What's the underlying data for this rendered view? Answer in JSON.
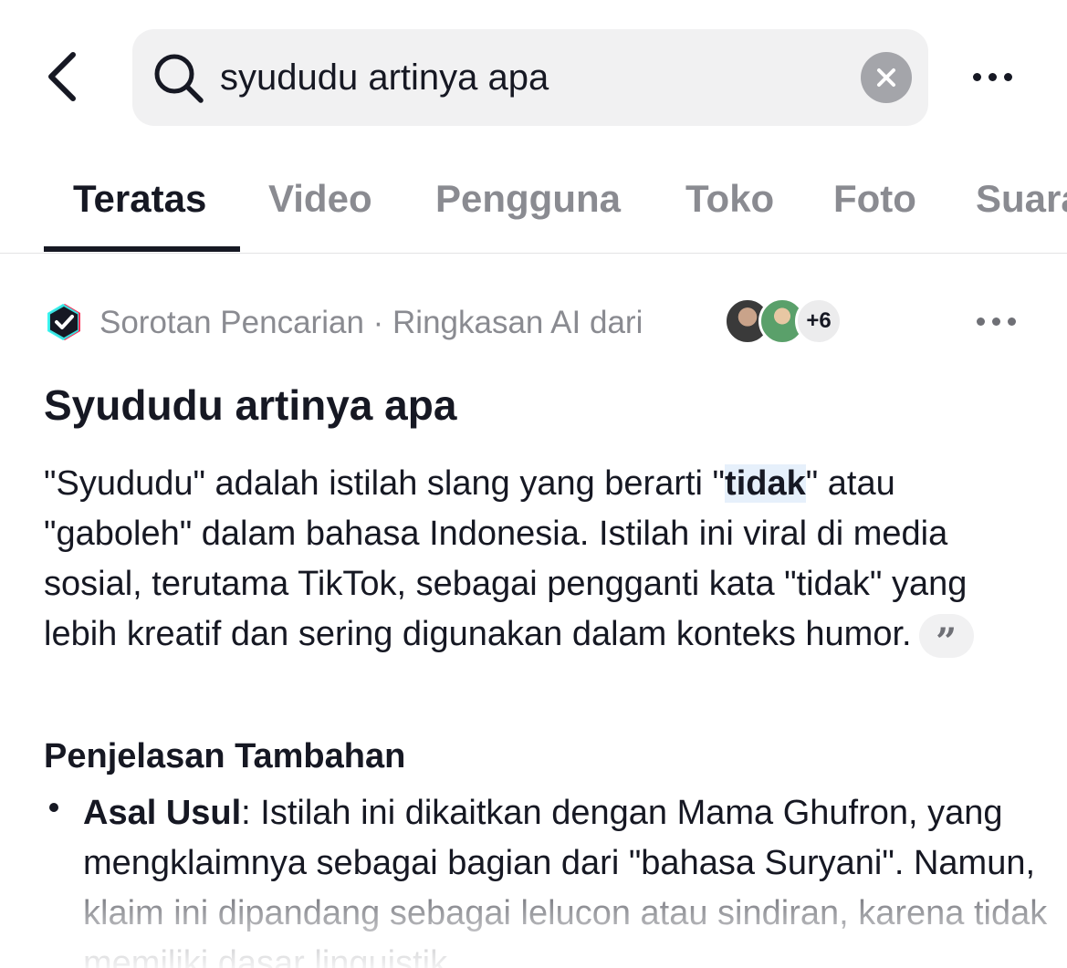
{
  "search": {
    "query": "syududu artinya apa"
  },
  "tabs": [
    {
      "label": "Teratas",
      "active": true
    },
    {
      "label": "Video",
      "active": false
    },
    {
      "label": "Pengguna",
      "active": false
    },
    {
      "label": "Toko",
      "active": false
    },
    {
      "label": "Foto",
      "active": false
    },
    {
      "label": "Suara",
      "active": false
    }
  ],
  "source": {
    "label": "Sorotan Pencarian · Ringkasan AI dari",
    "more_count": "+6"
  },
  "article": {
    "title": "Syududu artinya apa",
    "para_pre": "\"Syududu\" adalah istilah slang yang berarti \"",
    "para_highlight": "tidak",
    "para_post": "\" atau \"gaboleh\" dalam bahasa Indonesia. Istilah ini viral di media sosial, terutama TikTok, sebagai pengganti kata \"tidak\" yang lebih kreatif dan sering digunakan dalam konteks humor.",
    "quote_icon_glyph": "”",
    "subheading": "Penjelasan Tambahan",
    "bullet_label": "Asal Usul",
    "bullet_text": ": Istilah ini dikaitkan dengan Mama Ghufron, yang mengklaimnya sebagai bagian dari \"bahasa Suryani\". Namun, klaim ini dipandang sebagai lelucon atau sindiran, karena tidak memiliki dasar linguistik"
  },
  "colors": {
    "text": "#161823",
    "muted": "#8a8b91",
    "highlight": "#e6f0fb",
    "search_bg": "#f1f1f2"
  }
}
